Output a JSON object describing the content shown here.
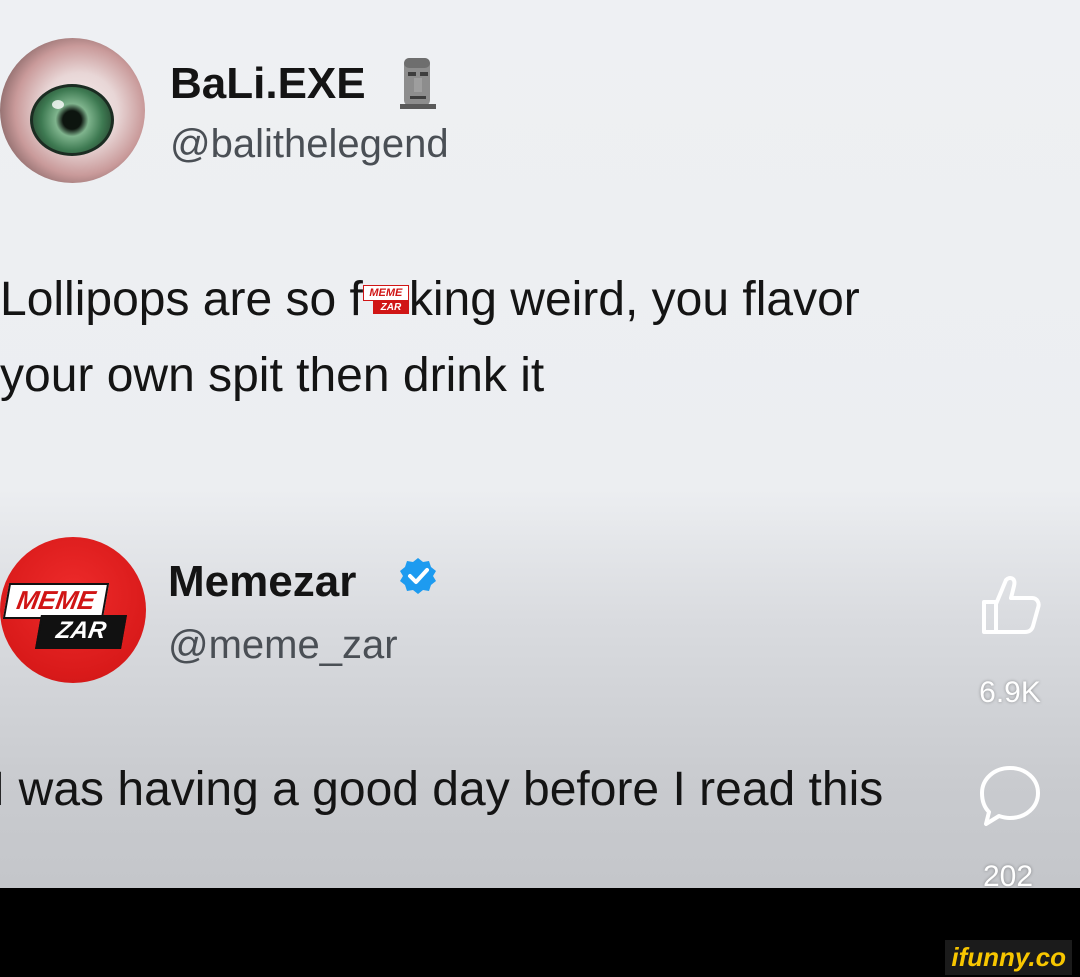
{
  "tweet1": {
    "display_name": "BaLi.EXE",
    "handle": "@balithelegend",
    "text_line1_pre": "Lollipops are so f",
    "text_line1_post": "king weird, you flavor",
    "text_line2": "your own spit then drink it",
    "censor_top": "MEME",
    "censor_bottom": "ZAR",
    "avatar_icon": "eyeball-avatar",
    "badge_icon": "moai-emoji-icon"
  },
  "tweet2": {
    "display_name": "Memezar",
    "handle": "@meme_zar",
    "text": "I was having a good day before I read this",
    "avatar_top": "MEME",
    "avatar_bottom": "ZAR",
    "badge_icon": "verified-badge-icon",
    "badge_color": "#1d9bf0",
    "avatar_color": "#d91a1a"
  },
  "actions": {
    "like_count": "6.9K",
    "comment_count": "202",
    "like_icon": "thumbs-up-icon",
    "comment_icon": "speech-bubble-icon"
  },
  "watermark": "ifunny.co"
}
